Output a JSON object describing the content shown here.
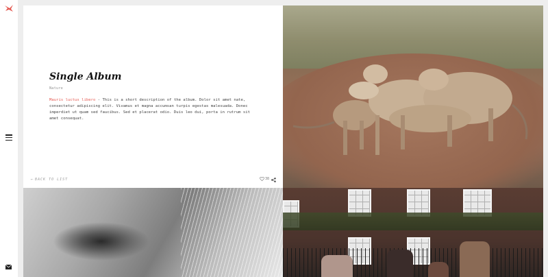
{
  "brand": {
    "logo": "bird-logo-icon",
    "accent_color": "#e55a52"
  },
  "sidebar": {
    "menu_icon": "hamburger-menu-icon",
    "mail_icon": "envelope-icon"
  },
  "album": {
    "title": "Single Album",
    "category": "Nature",
    "description_lead": "Mauris luctus libero",
    "description_body": " - This is a short description of the album. Dolor sit amet nate, consectetur adipiscing elit. Vivamus et magna accumsan turpis egestas malesuada. Donec imperdiet ut quam sed faucibus. Sed et placerat odio. Duis leo dui, porta in rutrum sit amet consequat.",
    "back_label": "BACK TO LIST",
    "like_count": "38"
  },
  "gallery": {
    "photos": [
      {
        "subject": "lions"
      },
      {
        "subject": "eye"
      },
      {
        "subject": "people"
      }
    ]
  }
}
